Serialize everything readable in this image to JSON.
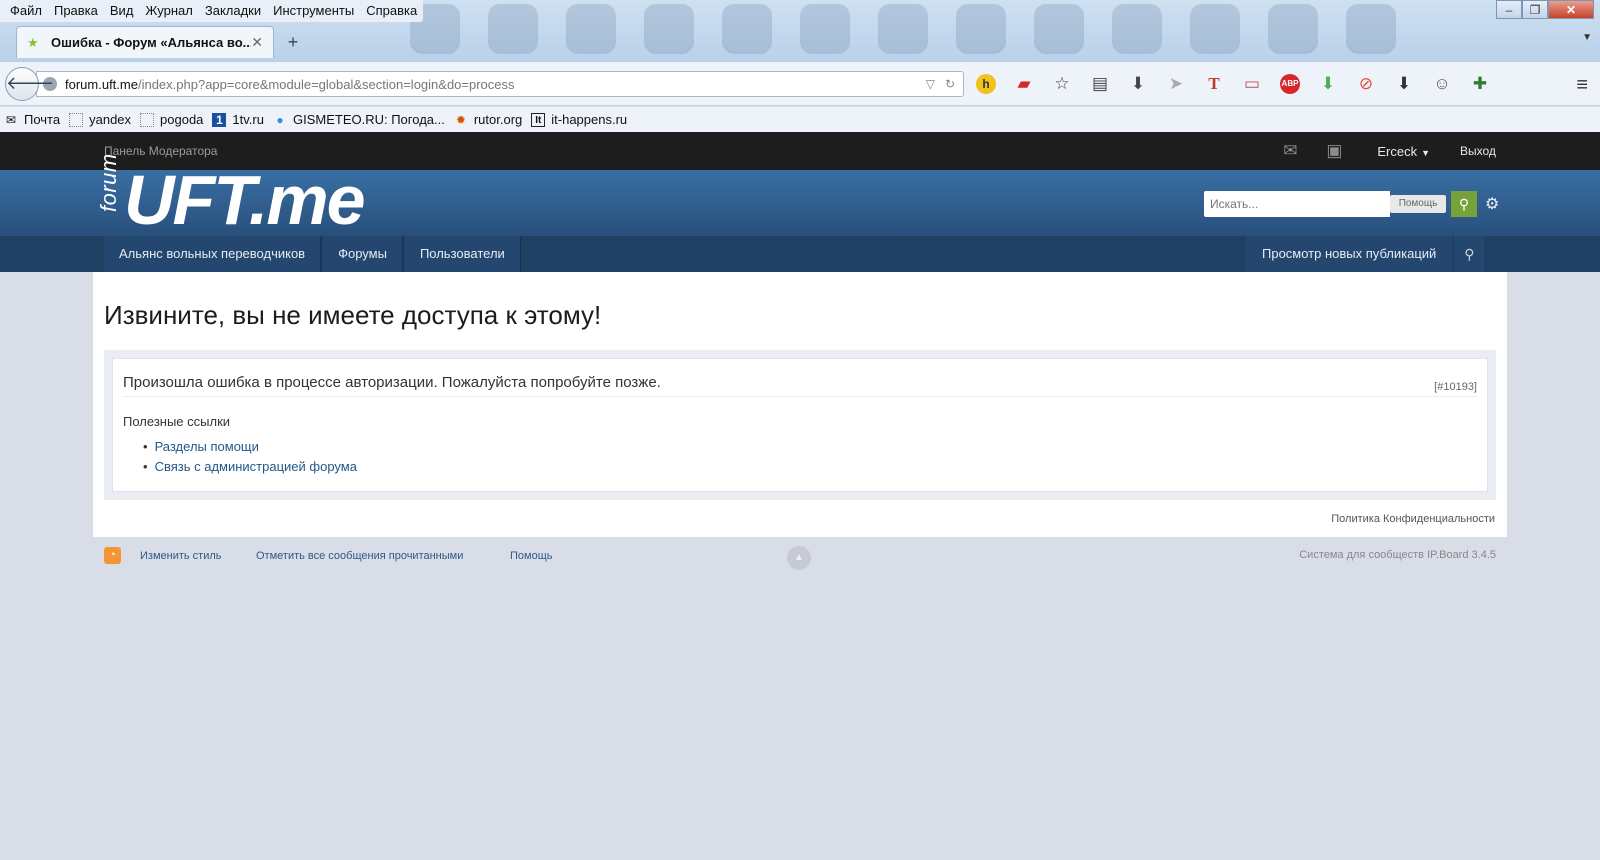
{
  "browser": {
    "menu": [
      "Файл",
      "Правка",
      "Вид",
      "Журнал",
      "Закладки",
      "Инструменты",
      "Справка"
    ],
    "tab_title": "Ошибка - Форум «Альянса во...",
    "url_host": "forum.uft.me",
    "url_path": "/index.php?app=core&module=global&section=login&do=process",
    "bookmarks": [
      "Почта",
      "yandex",
      "pogoda",
      "1tv.ru",
      "GISMETEO.RU: Погода...",
      "rutor.org",
      "it-happens.ru"
    ]
  },
  "site": {
    "mod_panel": "Панель Модератора",
    "username": "Ercеck",
    "logout": "Выход",
    "logo_small": "forum",
    "logo_main": "UFT.me",
    "search_placeholder": "Искать...",
    "search_help": "Помощь",
    "nav_tabs": [
      "Альянс вольных переводчиков",
      "Форумы",
      "Пользователи"
    ],
    "nav_new_posts": "Просмотр новых публикаций",
    "page_title": "Извините, вы не имеете доступа к этому!",
    "error_message": "Произошла ошибка в процессе авторизации. Пожалуйста попробуйте позже.",
    "error_code": "[#10193]",
    "useful_links_title": "Полезные ссылки",
    "useful_links": [
      "Разделы помощи",
      "Связь с администрацией форума"
    ],
    "privacy": "Политика Конфиденциальности",
    "footer_links": [
      "Изменить стиль",
      "Отметить все сообщения прочитанными",
      "Помощь"
    ],
    "powered_by": "Система для сообществ IP.Board 3.4.5"
  },
  "colors": {
    "header": "#2f5d8f",
    "nav": "#1f3f63",
    "mod_bar": "#1d1d1d",
    "link": "#225985",
    "search_button": "#76a339"
  }
}
